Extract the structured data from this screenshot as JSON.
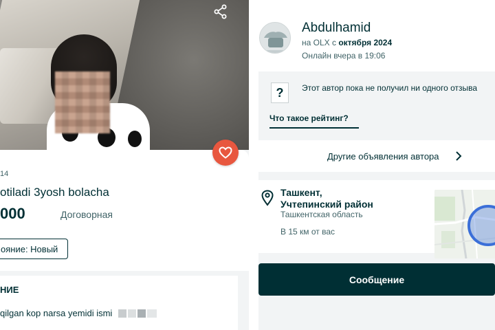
{
  "left_panel": {
    "date": "14",
    "title": "otiladi 3yosh bolacha",
    "price": "000",
    "negotiable": "Договорная",
    "condition": "ояние: Новый",
    "description_header": "НИЕ",
    "description_text": "qilgan kop narsa yemidi ismi"
  },
  "seller": {
    "name": "Abdulhamid",
    "since_prefix": "на OLX с",
    "since_date": "октября 2024",
    "online": "Онлайн вчера в 19:06",
    "no_reviews": "Этот автор пока не получил ни одного отзыва",
    "what_is_rating": "Что такое рейтинг?",
    "other_ads": "Другие объявления автора"
  },
  "location": {
    "city_line1": "Ташкент,",
    "city_line2": "Учтепинский район",
    "region": "Ташкентская область",
    "distance": "В 15 км от вас"
  },
  "actions": {
    "message_button": "Сообщение"
  },
  "colors": {
    "brand_dark": "#002f34",
    "heart_red": "#e8573f",
    "muted_text": "#406367",
    "map_highlight": "#3b6fd8"
  },
  "icons": [
    "share-icon",
    "heart-icon",
    "question-icon",
    "chevron-right-icon",
    "location-pin-icon"
  ]
}
